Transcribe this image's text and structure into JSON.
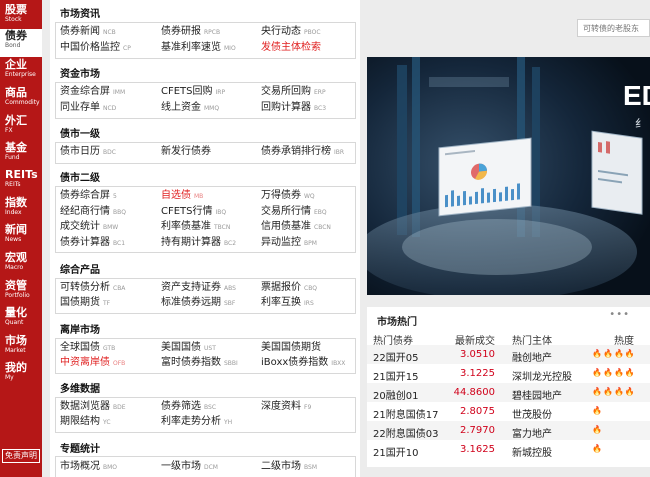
{
  "sidebar": {
    "items": [
      {
        "cn": "股票",
        "en": "Stock"
      },
      {
        "cn": "债券",
        "en": "Bond"
      },
      {
        "cn": "企业",
        "en": "Enterprise"
      },
      {
        "cn": "商品",
        "en": "Commodity"
      },
      {
        "cn": "外汇",
        "en": "FX"
      },
      {
        "cn": "基金",
        "en": "Fund"
      },
      {
        "cn": "REITs",
        "en": "REITs"
      },
      {
        "cn": "指数",
        "en": "Index"
      },
      {
        "cn": "新闻",
        "en": "News"
      },
      {
        "cn": "宏观",
        "en": "Macro"
      },
      {
        "cn": "资管",
        "en": "Portfolio"
      },
      {
        "cn": "量化",
        "en": "Quant"
      },
      {
        "cn": "市场",
        "en": "Market"
      },
      {
        "cn": "我的",
        "en": "My"
      }
    ],
    "disclaimer": "免责声明"
  },
  "sections": [
    {
      "title": "市场资讯",
      "links": [
        {
          "text": "债券新闻",
          "code": "NCB"
        },
        {
          "text": "债券研报",
          "code": "RPCB"
        },
        {
          "text": "央行动态",
          "code": "PBOC"
        },
        {
          "text": "中国价格监控",
          "code": "CP"
        },
        {
          "text": "基准利率速览",
          "code": "MIO"
        },
        {
          "text": "发债主体检索",
          "code": ""
        }
      ]
    },
    {
      "title": "资金市场",
      "links": [
        {
          "text": "资金综合屏",
          "code": "IMM"
        },
        {
          "text": "CFETS回购",
          "code": "IRP"
        },
        {
          "text": "交易所回购",
          "code": "ERP"
        },
        {
          "text": "同业存单",
          "code": "NCD"
        },
        {
          "text": "线上资金",
          "code": "MMQ"
        },
        {
          "text": "回购计算器",
          "code": "BC3"
        }
      ]
    },
    {
      "title": "债市一级",
      "links": [
        {
          "text": "债市日历",
          "code": "BDC"
        },
        {
          "text": "新发行债券",
          "code": ""
        },
        {
          "text": "债券承销排行榜",
          "code": "IBR"
        }
      ]
    },
    {
      "title": "债市二级",
      "links": [
        {
          "text": "债券综合屏",
          "code": "5"
        },
        {
          "text": "自选债",
          "code": "MB"
        },
        {
          "text": "万得债券",
          "code": "WQ"
        },
        {
          "text": "经纪商行情",
          "code": "BBQ"
        },
        {
          "text": "CFETS行情",
          "code": "IBQ"
        },
        {
          "text": "交易所行情",
          "code": "EBQ"
        },
        {
          "text": "成交统计",
          "code": "BMW"
        },
        {
          "text": "利率债基准",
          "code": "TBCN"
        },
        {
          "text": "信用债基准",
          "code": "CBCN"
        },
        {
          "text": "债券计算器",
          "code": "BC1"
        },
        {
          "text": "持有期计算器",
          "code": "BC2"
        },
        {
          "text": "异动监控",
          "code": "BPM"
        }
      ]
    },
    {
      "title": "综合产品",
      "links": [
        {
          "text": "可转债分析",
          "code": "CBA"
        },
        {
          "text": "资产支持证券",
          "code": "ABS"
        },
        {
          "text": "票据报价",
          "code": "CBQ"
        },
        {
          "text": "国债期货",
          "code": "TF"
        },
        {
          "text": "标准债券远期",
          "code": "SBF"
        },
        {
          "text": "利率互换",
          "code": "IRS"
        }
      ]
    },
    {
      "title": "离岸市场",
      "links": [
        {
          "text": "全球国债",
          "code": "GTB"
        },
        {
          "text": "美国国债",
          "code": "UST"
        },
        {
          "text": "美国国债期货",
          "code": ""
        },
        {
          "text": "中资离岸债",
          "code": "OFB"
        },
        {
          "text": "富时债券指数",
          "code": "SBBI"
        },
        {
          "text": "iBoxx债券指数",
          "code": "IBXX"
        }
      ]
    },
    {
      "title": "多维数据",
      "links": [
        {
          "text": "数据浏览器",
          "code": "BDE"
        },
        {
          "text": "债券筛选",
          "code": "BSC"
        },
        {
          "text": "深度资料",
          "code": "F9"
        },
        {
          "text": "期限结构",
          "code": "YC"
        },
        {
          "text": "利率走势分析",
          "code": "YH"
        }
      ]
    },
    {
      "title": "专题统计",
      "links": [
        {
          "text": "市场概况",
          "code": "BMO"
        },
        {
          "text": "一级市场",
          "code": "DCM"
        },
        {
          "text": "二级市场",
          "code": "BSM"
        }
      ]
    }
  ],
  "search": {
    "placeholder": "可转债的老股东"
  },
  "banner": {
    "big_text": "ED",
    "small_text": "纟"
  },
  "hot": {
    "title": "市场热门",
    "more": "•••",
    "columns": [
      "热门债券",
      "最新成交",
      "热门主体",
      "热度"
    ],
    "rows": [
      {
        "bond": "22国开05",
        "price": "3.0510",
        "issuer": "融创地产",
        "heat": 4
      },
      {
        "bond": "21国开15",
        "price": "3.1225",
        "issuer": "深圳龙光控股",
        "heat": 4
      },
      {
        "bond": "20融创01",
        "price": "44.8600",
        "issuer": "碧桂园地产",
        "heat": 4
      },
      {
        "bond": "21附息国债17",
        "price": "2.8075",
        "issuer": "世茂股份",
        "heat": 1
      },
      {
        "bond": "22附息国债03",
        "price": "2.7970",
        "issuer": "富力地产",
        "heat": 1
      },
      {
        "bond": "21国开10",
        "price": "3.1625",
        "issuer": "新城控股",
        "heat": 1
      }
    ]
  },
  "colors": {
    "brand_red": "#b51717",
    "link_red": "#e02020",
    "price_red": "#d0021b"
  }
}
